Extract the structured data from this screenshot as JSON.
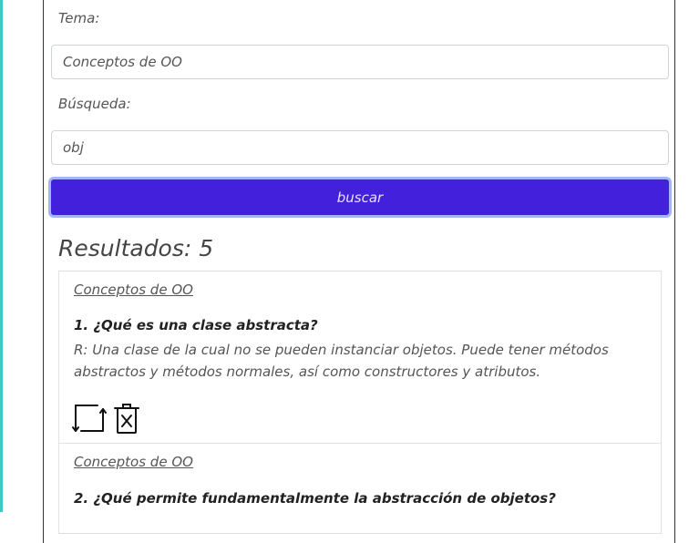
{
  "form": {
    "topic_label": "Tema:",
    "topic_value": "Conceptos de OO",
    "search_label": "Búsqueda:",
    "search_value": "obj",
    "search_button": "buscar"
  },
  "results": {
    "heading": "Resultados: 5",
    "items": [
      {
        "topic": "Conceptos de OO",
        "question": "1. ¿Qué es una clase abstracta?",
        "answer": "R: Una clase de la cual no se pueden instanciar objetos. Puede tener métodos abstractos y métodos normales, así como constructores y atributos."
      },
      {
        "topic": "Conceptos de OO",
        "question": "2. ¿Qué permite fundamentalmente la abstracción de objetos?"
      }
    ]
  },
  "icons": [
    "swap-icon",
    "delete-icon"
  ],
  "colors": {
    "button": "#4320dc",
    "accent": "#3ec6cf"
  }
}
